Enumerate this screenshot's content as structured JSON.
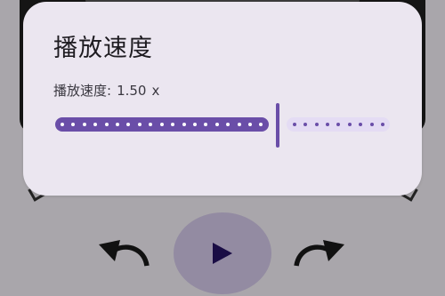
{
  "dialog": {
    "title": "播放速度",
    "speed_label": "播放速度:",
    "speed_value": "1.50",
    "speed_unit": "x"
  },
  "slider": {
    "fraction": 0.66,
    "tick_count": 30
  },
  "colors": {
    "accent": "#6a4ea8",
    "track_inactive": "#e4dcf4",
    "dialog_bg": "#ebe6f0",
    "play_button_bg": "#938ba2"
  },
  "icons": {
    "rewind": "rewind-icon",
    "play": "play-icon",
    "forward": "fast-forward-icon"
  }
}
